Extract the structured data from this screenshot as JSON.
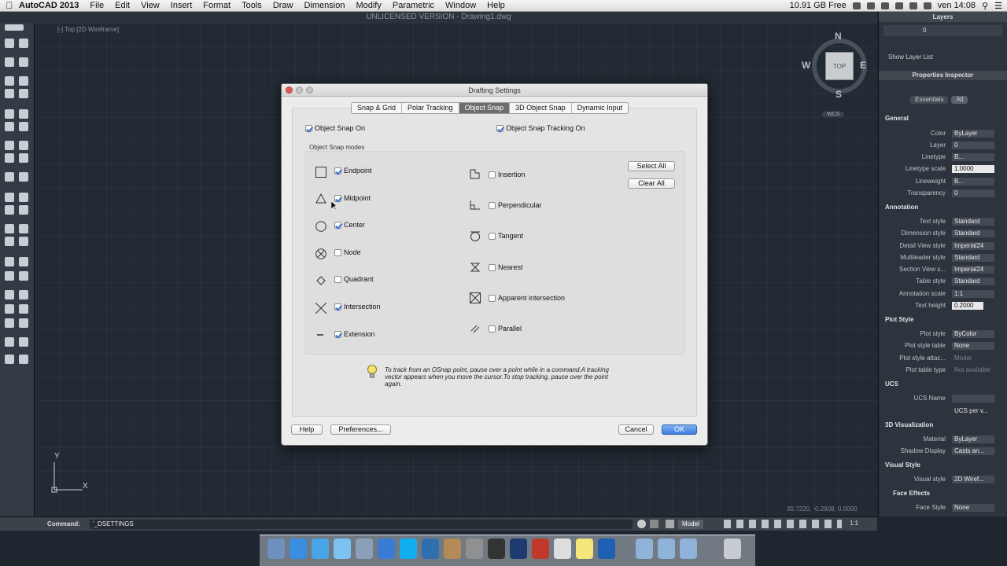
{
  "menubar": {
    "app": "AutoCAD 2013",
    "items": [
      "File",
      "Edit",
      "View",
      "Insert",
      "Format",
      "Tools",
      "Draw",
      "Dimension",
      "Modify",
      "Parametric",
      "Window",
      "Help"
    ],
    "disk_free": "10.91 GB Free",
    "clock": "ven 14:08"
  },
  "window": {
    "title": "UNLICENSED VERSION - Drawing1.dwg"
  },
  "viewport": {
    "label": "[-] Top  [2D Wireframe]"
  },
  "viewcube": {
    "n": "N",
    "s": "S",
    "e": "E",
    "w": "W",
    "face": "TOP",
    "wcs": "WCS"
  },
  "ucs": {
    "x": "X",
    "y": "Y"
  },
  "coords": "39.7220, -0.2908, 0.0000",
  "command": {
    "label": "Command:",
    "value": "'_DSETTINGS"
  },
  "status": {
    "model": "Model",
    "scale": "1:1"
  },
  "layers": {
    "title": "Layers",
    "current": "0",
    "show": "Show Layer List"
  },
  "props": {
    "title": "Properties Inspector",
    "tab_essentials": "Essentials",
    "tab_all": "All",
    "general": {
      "title": "General",
      "rows": [
        [
          "Color",
          "ByLayer"
        ],
        [
          "Layer",
          "0"
        ],
        [
          "Linetype",
          "B..."
        ],
        [
          "Linetype scale",
          "1.0000"
        ],
        [
          "Lineweight",
          "B..."
        ],
        [
          "Transparency",
          "0"
        ]
      ]
    },
    "annotation": {
      "title": "Annotation",
      "rows": [
        [
          "Text style",
          "Standard"
        ],
        [
          "Dimension style",
          "Standard"
        ],
        [
          "Detail View style",
          "Imperial24"
        ],
        [
          "Multileader style",
          "Standard"
        ],
        [
          "Section View s...",
          "Imperial24"
        ],
        [
          "Table style",
          "Standard"
        ],
        [
          "Annotation scale",
          "1:1"
        ],
        [
          "Text height",
          "0.2000"
        ]
      ]
    },
    "plot": {
      "title": "Plot Style",
      "rows": [
        [
          "Plot style",
          "ByColor"
        ],
        [
          "Plot style table",
          "None"
        ],
        [
          "Plot style attac...",
          "Model"
        ],
        [
          "Plot table type",
          "Not available"
        ]
      ]
    },
    "ucs": {
      "title": "UCS",
      "rows": [
        [
          "UCS Name",
          ""
        ]
      ],
      "per_view": "UCS per v..."
    },
    "vis3d": {
      "title": "3D Visualization",
      "rows": [
        [
          "Material",
          "ByLayer"
        ],
        [
          "Shadow Display",
          "Casts an..."
        ]
      ]
    },
    "visual": {
      "title": "Visual Style",
      "rows": [
        [
          "Visual style",
          "2D Wiref..."
        ]
      ]
    },
    "face": {
      "title": "Face Effects",
      "rows": [
        [
          "Face Style",
          "None"
        ]
      ]
    }
  },
  "dialog": {
    "title": "Drafting Settings",
    "tabs": [
      "Snap & Grid",
      "Polar Tracking",
      "Object Snap",
      "3D Object Snap",
      "Dynamic Input"
    ],
    "active_tab": "Object Snap",
    "osnap_on": "Object Snap On",
    "tracking_on": "Object Snap Tracking On",
    "modes_label": "Object Snap modes",
    "left_modes": [
      {
        "label": "Endpoint",
        "checked": true
      },
      {
        "label": "Midpoint",
        "checked": true
      },
      {
        "label": "Center",
        "checked": true
      },
      {
        "label": "Node",
        "checked": false
      },
      {
        "label": "Quadrant",
        "checked": false
      },
      {
        "label": "Intersection",
        "checked": true
      },
      {
        "label": "Extension",
        "checked": true
      }
    ],
    "right_modes": [
      {
        "label": "Insertion",
        "checked": false
      },
      {
        "label": "Perpendicular",
        "checked": false
      },
      {
        "label": "Tangent",
        "checked": false
      },
      {
        "label": "Nearest",
        "checked": false
      },
      {
        "label": "Apparent intersection",
        "checked": false
      },
      {
        "label": "Parallel",
        "checked": false
      }
    ],
    "select_all": "Select All",
    "clear_all": "Clear All",
    "hint": "To track from an OSnap point, pause over a point while in a command.A tracking vector appears when you move the cursor.To stop tracking, pause over the point again.",
    "help": "Help",
    "preferences": "Preferences...",
    "cancel": "Cancel",
    "ok": "OK"
  }
}
